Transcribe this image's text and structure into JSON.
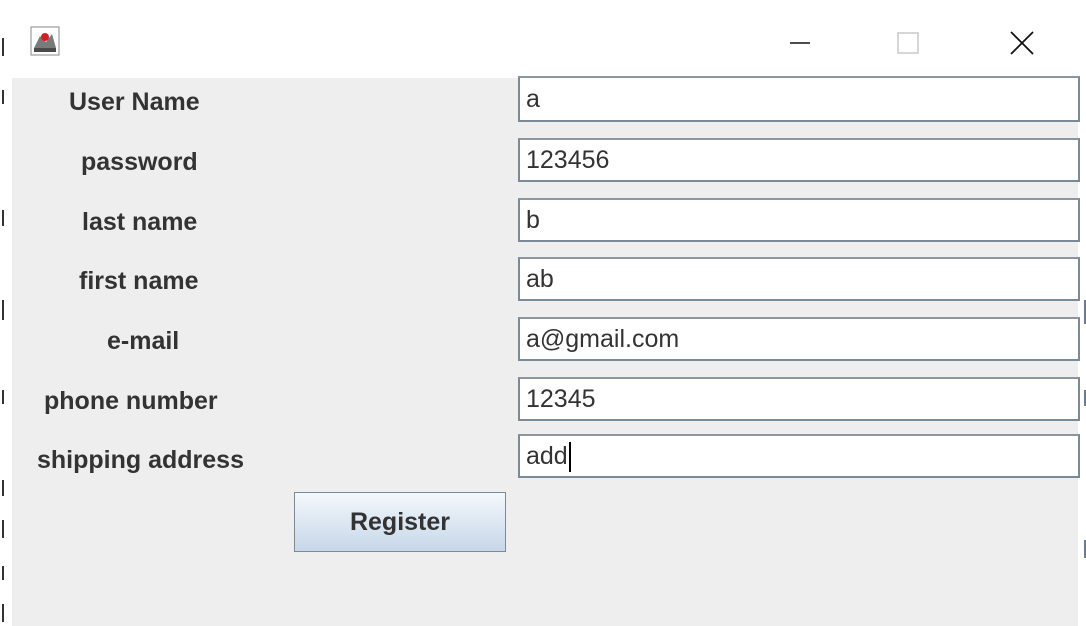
{
  "window": {
    "title": "",
    "controls": {
      "minimize_icon": "minimize-icon",
      "maximize_icon": "maximize-icon",
      "close_icon": "close-icon"
    }
  },
  "form": {
    "fields": [
      {
        "label": "User Name",
        "value": "a"
      },
      {
        "label": "password",
        "value": "123456"
      },
      {
        "label": "last name",
        "value": "b"
      },
      {
        "label": "first name",
        "value": "ab"
      },
      {
        "label": "e-mail",
        "value": "a@gmail.com"
      },
      {
        "label": "phone number",
        "value": "12345"
      },
      {
        "label": "shipping address",
        "value": "add"
      }
    ],
    "register_label": "Register"
  },
  "colors": {
    "client_background": "#eeeeee",
    "label_text": "#333333",
    "field_border": "#7a8a99"
  }
}
